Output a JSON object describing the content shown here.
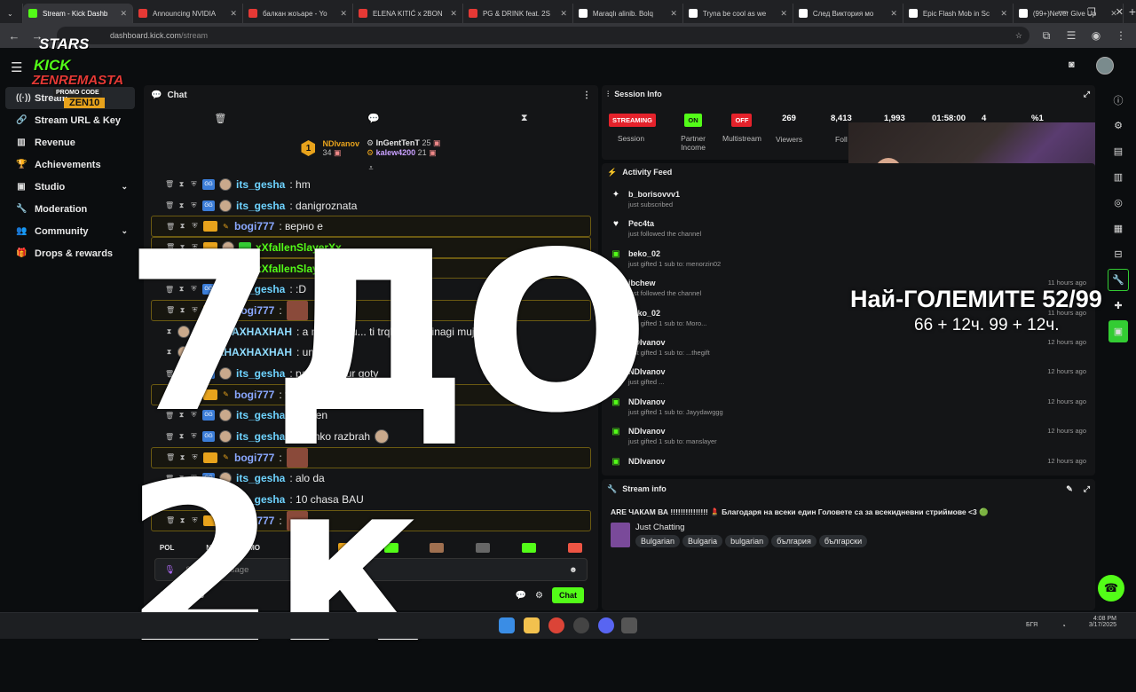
{
  "browser": {
    "tabs": [
      {
        "label": "Stream - Kick Dashb",
        "color": "#53fc18",
        "active": true
      },
      {
        "label": "Announcing NVIDIA",
        "color": "#e53935"
      },
      {
        "label": "балкан жоъаре - Yo",
        "color": "#e53935"
      },
      {
        "label": "ELENA KITIĆ x 2BON",
        "color": "#e53935"
      },
      {
        "label": "PG & DRINK feat. 2S",
        "color": "#e53935"
      },
      {
        "label": "Maraqlı alinib. Bolq",
        "color": "#ffffff"
      },
      {
        "label": "Tryna be cool as we",
        "color": "#ffffff"
      },
      {
        "label": "След Виктория мо",
        "color": "#ffffff"
      },
      {
        "label": "Epic Flash Mob in Sc",
        "color": "#ffffff"
      },
      {
        "label": "(99+)Never Give Up",
        "color": "#ffffff"
      }
    ],
    "url_prefix": "dashboard.kick.com",
    "url_path": "/stream"
  },
  "sidebar": {
    "items": [
      {
        "label": "Stream",
        "icon": "broadcast-icon",
        "glyph": "((·))",
        "active": true
      },
      {
        "label": "Stream URL & Key",
        "icon": "link-icon",
        "glyph": "🔗"
      },
      {
        "label": "Revenue",
        "icon": "bar-chart-icon",
        "glyph": "▥"
      },
      {
        "label": "Achievements",
        "icon": "trophy-icon",
        "glyph": "🏆"
      },
      {
        "label": "Studio",
        "icon": "studio-icon",
        "glyph": "▣",
        "chevron": "⌄"
      },
      {
        "label": "Moderation",
        "icon": "wrench-icon",
        "glyph": "🔧"
      },
      {
        "label": "Community",
        "icon": "people-icon",
        "glyph": "👥",
        "chevron": "⌄"
      },
      {
        "label": "Drops & rewards",
        "icon": "gift-icon",
        "glyph": "🎁"
      }
    ]
  },
  "promo": {
    "stars_label": "STARS",
    "line1": "KICK",
    "line2": "ZENREMASTA",
    "code_label": "PROMO CODE",
    "code": "ZEN10"
  },
  "chat": {
    "title": "Chat",
    "gifters": [
      {
        "name": "NDIvanov",
        "count": "34"
      },
      {
        "name": "InGentTenT",
        "count": "25"
      },
      {
        "name": "kalew4200",
        "count": "21"
      }
    ],
    "top_badge": "1",
    "messages": [
      {
        "user": "its_gesha",
        "color": "#6ed3ff",
        "text": ": hm",
        "type": "gesha"
      },
      {
        "user": "its_gesha",
        "color": "#6ed3ff",
        "text": ": danigroznata",
        "type": "gesha"
      },
      {
        "user": "bogi777",
        "color": "#8aa8ff",
        "text": ": верно е",
        "type": "bogi",
        "hl": true
      },
      {
        "user": "xXfallenSlayerXx",
        "color": "#53fc18",
        "text": "",
        "type": "fallen",
        "hl": true
      },
      {
        "user": "xXfallenSlayerXx",
        "color": "#53fc18",
        "text": "",
        "type": "fallen",
        "hl": true,
        "emote": true
      },
      {
        "user": "its_gesha",
        "color": "#6ed3ff",
        "text": ": :D",
        "type": "gesha"
      },
      {
        "user": "bogi777",
        "color": "#8aa8ff",
        "text": ":",
        "type": "bogi",
        "hl": true,
        "emote": true
      },
      {
        "user": "PHAXHAXHAXHAH",
        "color": "#8fdcff",
        "text": ": a neshto ku... ti trqbv... ce vinagi mujete domi",
        "type": "pha"
      },
      {
        "user": "PHAXHAXHAXHAH",
        "color": "#8fdcff",
        "text": ": um",
        "type": "pha"
      },
      {
        "user": "its_gesha",
        "color": "#6ed3ff",
        "text": ": pa... e dobur goty",
        "type": "gesha"
      },
      {
        "user": "bogi777",
        "color": "#8aa8ff",
        "text": ": т...",
        "type": "bogi",
        "hl": true
      },
      {
        "user": "its_gesha",
        "color": "#6ed3ff",
        "text": ": ...ozen",
        "type": "gesha"
      },
      {
        "user": "its_gesha",
        "color": "#6ed3ff",
        "text": ": vsichko razbrah",
        "type": "gesha",
        "face": true
      },
      {
        "user": "bogi777",
        "color": "#8aa8ff",
        "text": ":",
        "type": "bogi",
        "hl": true,
        "emote": true
      },
      {
        "user": "its_gesha",
        "color": "#6ed3ff",
        "text": ": alo da",
        "type": "gesha"
      },
      {
        "user": "its_gesha",
        "color": "#6ed3ff",
        "text": ": 10 chasa BAU",
        "type": "gesha"
      },
      {
        "user": "bogi777",
        "color": "#8aa8ff",
        "text": ":",
        "type": "bogi",
        "hl": true,
        "emote": true
      }
    ],
    "quick": [
      "POL",
      "NO",
      "MO"
    ],
    "input_placeholder": "Send a message",
    "viewer_count": "0",
    "send_label": "Chat"
  },
  "session": {
    "title": "Session Info",
    "stats": [
      {
        "pill": "STREAMING",
        "pill_color": "#e5222b",
        "label": "Session"
      },
      {
        "pill": "ON",
        "pill_color": "#53fc18",
        "label": "Partner Income"
      },
      {
        "pill": "OFF",
        "pill_color": "#e5222b",
        "label": "Multistream"
      },
      {
        "num": "269",
        "label": "Viewers"
      },
      {
        "num": "8,413",
        "label": "Foll"
      },
      {
        "num": "1,993",
        "label": ""
      },
      {
        "num": "01:58:00",
        "label": ""
      },
      {
        "num": "4",
        "label": ""
      },
      {
        "num": "%1",
        "label": ""
      }
    ]
  },
  "activity": {
    "title": "Activity Feed",
    "items": [
      {
        "who": "b_borisovvv1",
        "what": "just subscribed",
        "when": "",
        "icon": "sparkle-icon",
        "glyph": "✦",
        "green": false
      },
      {
        "who": "Pec4ta",
        "what": "just followed the channel",
        "when": "",
        "icon": "heart-icon",
        "glyph": "♥",
        "green": false
      },
      {
        "who": "beko_02",
        "what": "just gifted 1 sub to: menorzin02",
        "when": "",
        "icon": "gift-icon",
        "glyph": "▣",
        "green": true
      },
      {
        "who": "ibchew",
        "what": "just followed the channel",
        "when": "11 hours ago",
        "icon": "heart-icon",
        "glyph": "♥",
        "green": false
      },
      {
        "who": "beko_02",
        "what": "just gifted 1 sub to: Moro...",
        "when": "11 hours ago",
        "icon": "gift-icon",
        "glyph": "▣",
        "green": true
      },
      {
        "who": "NDIvanov",
        "what": "just gifted 1 sub to: ...thegift",
        "when": "12 hours ago",
        "icon": "gift-icon",
        "glyph": "▣",
        "green": true
      },
      {
        "who": "NDIvanov",
        "what": "just gifted ...",
        "when": "12 hours ago",
        "icon": "gift-icon",
        "glyph": "▣",
        "green": true
      },
      {
        "who": "NDIvanov",
        "what": "just gifted 1 sub to: Jayydawggg",
        "when": "12 hours ago",
        "icon": "gift-icon",
        "glyph": "▣",
        "green": true
      },
      {
        "who": "NDIvanov",
        "what": "just gifted 1 sub to: manslayer",
        "when": "12 hours ago",
        "icon": "gift-icon",
        "glyph": "▣",
        "green": true
      },
      {
        "who": "NDIvanov",
        "what": "",
        "when": "12 hours ago",
        "icon": "gift-icon",
        "glyph": "▣",
        "green": true
      }
    ]
  },
  "stream_info": {
    "title": "Stream info",
    "stream_title": "ARE ЧАКАМ ВА !!!!!!!!!!!!!!! 💄 Благодаря на всеки един Головете са за всекидневни стриймове <3 🟢",
    "category": "Just Chatting",
    "tags": [
      "Bulgarian",
      "Bulgaria",
      "bulgarian",
      "българия",
      "български"
    ]
  },
  "overlay": {
    "big_text": "7ДО 2к",
    "goal_main": "Най-ГОЛЕМИТЕ 52/99",
    "goal_sub": "66 + 12ч. 99 + 12ч."
  },
  "taskbar": {
    "lang": "БГЯ",
    "time": "4:08 PM",
    "date": "3/17/2025"
  }
}
